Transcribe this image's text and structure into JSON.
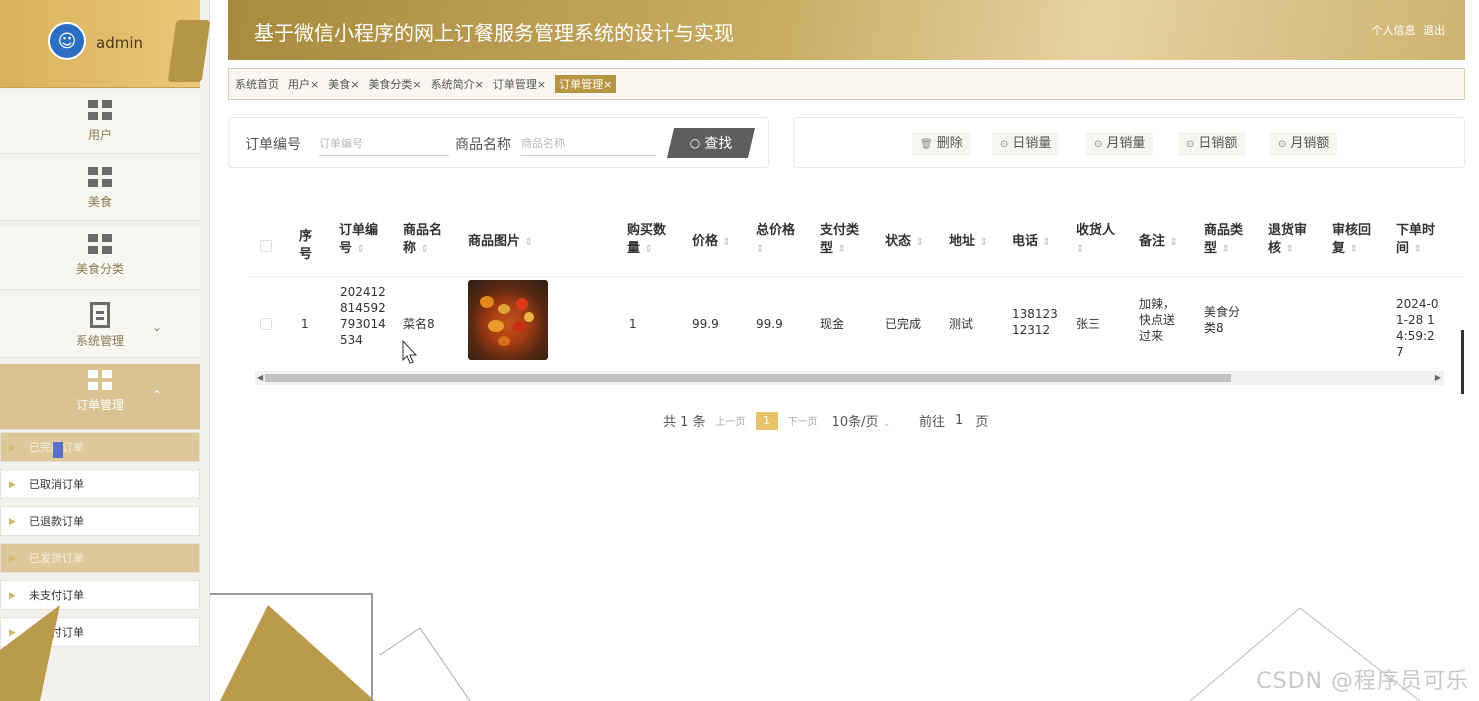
{
  "admin": {
    "name": "admin"
  },
  "sidebar": {
    "menus": [
      {
        "label": "用户"
      },
      {
        "label": "美食"
      },
      {
        "label": "美食分类"
      },
      {
        "label": "系统管理"
      },
      {
        "label": "订单管理"
      }
    ],
    "sub_items": [
      {
        "label": "已完成订单"
      },
      {
        "label": "已取消订单"
      },
      {
        "label": "已退款订单"
      },
      {
        "label": "已发货订单"
      },
      {
        "label": "未支付订单"
      },
      {
        "label": "已支付订单"
      }
    ]
  },
  "header": {
    "title": "基于微信小程序的网上订餐服务管理系统的设计与实现",
    "profile": "个人信息",
    "logout": "退出"
  },
  "tabs": [
    "系统首页",
    "用户×",
    "美食×",
    "美食分类×",
    "系统简介×",
    "订单管理×",
    "订单管理×"
  ],
  "search": {
    "order_label": "订单编号",
    "order_placeholder": "订单编号",
    "goods_label": "商品名称",
    "goods_placeholder": "商品名称",
    "button": "查找"
  },
  "actions": [
    "删除",
    "日销量",
    "月销量",
    "日销额",
    "月销额"
  ],
  "table": {
    "headers": [
      "序号",
      "订单编号",
      "商品名称",
      "商品图片",
      "购买数量",
      "价格",
      "总价格",
      "支付类型",
      "状态",
      "地址",
      "电话",
      "收货人",
      "备注",
      "商品类型",
      "退货审核",
      "审核回复",
      "下单时间"
    ],
    "rows": [
      {
        "index": "1",
        "order_no": "202412814592793014534",
        "goods_name": "菜名8",
        "qty": "1",
        "price": "99.9",
        "total": "99.9",
        "pay_type": "现金",
        "status": "已完成",
        "address": "测试",
        "phone": "13812312312",
        "receiver": "张三",
        "remark": "加辣，快点送过来",
        "goods_type": "美食分类8",
        "return_review": "",
        "review_reply": "",
        "order_time": "2024-01-28 14:59:27"
      }
    ]
  },
  "pager": {
    "total": "共 1 条",
    "prev": "上一页",
    "page": "1",
    "next": "下一页",
    "size": "10条/页",
    "goto": "前往",
    "goto_page": "1",
    "goto_unit": "页"
  },
  "watermark": "CSDN @程序员可乐",
  "colors": {
    "accent": "#b89641",
    "header": "#c9ad64",
    "sidebar_active": "#d9c393"
  }
}
